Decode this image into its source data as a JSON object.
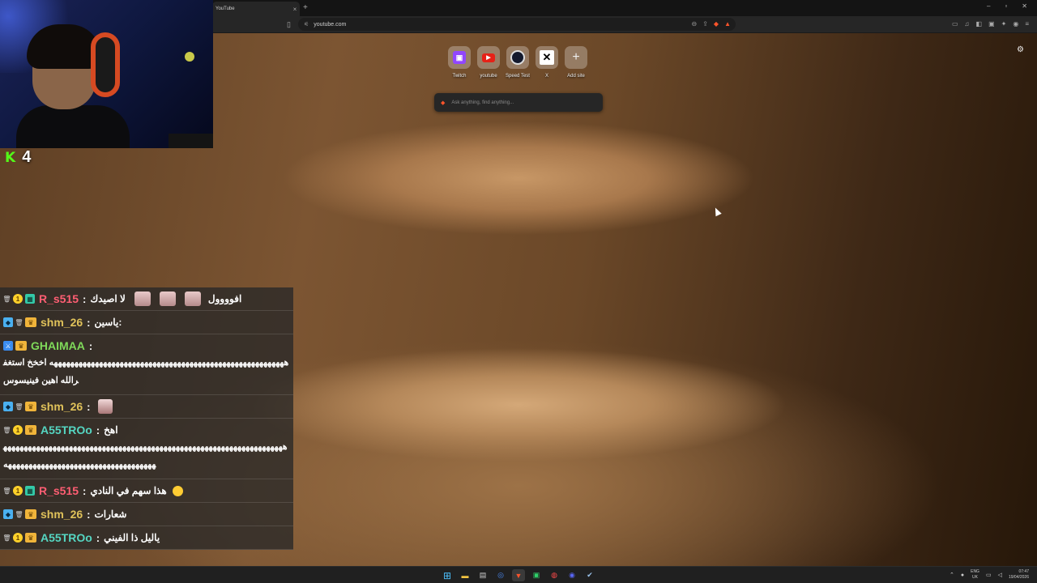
{
  "browser": {
    "tab_title": "YouTube",
    "tab_close": "×",
    "new_tab": "+",
    "url": "youtube.com",
    "window_controls": [
      "–",
      "▫",
      "✕"
    ]
  },
  "newtab": {
    "shortcuts": [
      {
        "label": "Twitch",
        "icon": "twitch-icon"
      },
      {
        "label": "youtube",
        "icon": "youtube-icon"
      },
      {
        "label": "Speed Test",
        "icon": "speedtest-icon"
      },
      {
        "label": "X",
        "icon": "x-icon"
      },
      {
        "label": "Add site",
        "icon": "plus-icon"
      }
    ],
    "search_placeholder": "Ask anything, find anything..."
  },
  "stream": {
    "kick_logo": "K",
    "viewer_count": "4"
  },
  "chat": {
    "messages": [
      {
        "user": "R_s515",
        "color": "#ff5e73",
        "text": "لا اصيدك",
        "trailing": "افوووول"
      },
      {
        "user": "shm_26",
        "color": "#e0c25a",
        "text": "ياسين:"
      },
      {
        "user": "GHAIMAA",
        "color": "#7fd95a",
        "text": "",
        "body": "هههههههههههههههههههههههههههههههههههههههههههههههههههههههههه اخخخ استغفرالله اهين فينيسوس"
      },
      {
        "user": "shm_26",
        "color": "#e0c25a",
        "text": ""
      },
      {
        "user": "A55TROo",
        "color": "#55d6c2",
        "text": "اهخ",
        "body": "هههههههههههههههههههههههههههههههههههههههههههههههههههههههههههههههههههههههههههههههههههههههههههههههههههههههههه"
      },
      {
        "user": "R_s515",
        "color": "#ff5e73",
        "text": "هذا سهم في النادي"
      },
      {
        "user": "shm_26",
        "color": "#e0c25a",
        "text": "شعارات"
      },
      {
        "user": "A55TROo",
        "color": "#55d6c2",
        "text": "ياليل ذا الفيني"
      }
    ],
    "separator": ":"
  },
  "taskbar": {
    "lang_top": "ENG",
    "lang_bottom": "UK",
    "time": "07:47",
    "date": "19/04/2026"
  }
}
